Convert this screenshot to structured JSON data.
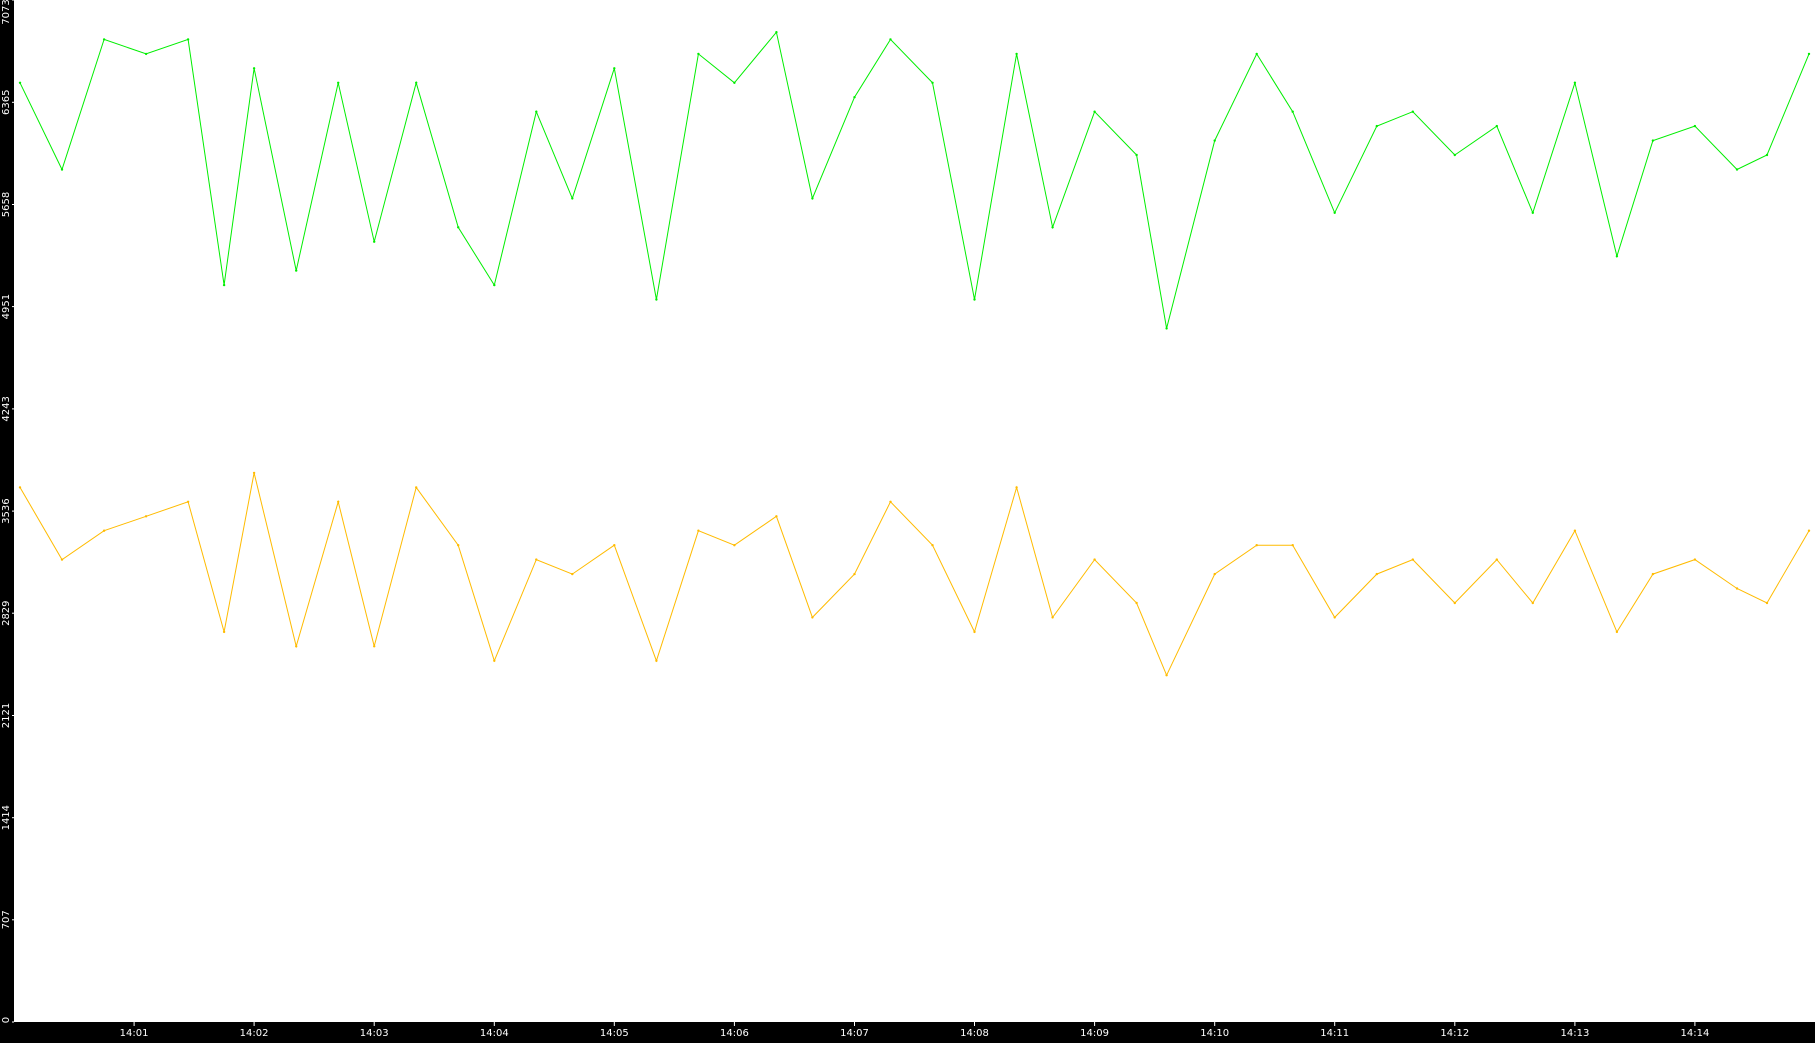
{
  "chart_data": {
    "type": "line",
    "title": "",
    "xlabel": "",
    "ylabel": "",
    "grid": false,
    "legend": "none",
    "colors": {
      "background": "#000000",
      "plot_area": "#ffffff",
      "axis_text": "#ffffff",
      "green_series": "#00ee00",
      "orange_series": "#ffbb00"
    },
    "y_ticks": [
      "0",
      "707",
      "1414",
      "2121",
      "2829",
      "3536",
      "4243",
      "4951",
      "5658",
      "6365",
      "7073"
    ],
    "ylim": [
      0,
      7073
    ],
    "x_ticks": [
      "14:01",
      "14:02",
      "14:03",
      "14:04",
      "14:05",
      "14:06",
      "14:07",
      "14:08",
      "14:09",
      "14:10",
      "14:11",
      "14:12",
      "14:13",
      "14:14"
    ],
    "x_tick_minutes": [
      1,
      2,
      3,
      4,
      5,
      6,
      7,
      8,
      9,
      10,
      11,
      12,
      13,
      14
    ],
    "xlim_minutes": [
      0,
      15
    ],
    "x_unit": "minutes after 14:00",
    "series": [
      {
        "key": "green",
        "x_minutes": [
          0.05,
          0.4,
          0.75,
          1.1,
          1.45,
          1.75,
          2.0,
          2.35,
          2.7,
          3.0,
          3.35,
          3.7,
          4.0,
          4.35,
          4.65,
          5.0,
          5.35,
          5.7,
          6.0,
          6.35,
          6.65,
          7.0,
          7.3,
          7.65,
          8.0,
          8.35,
          8.65,
          9.0,
          9.35,
          9.6,
          10.0,
          10.35,
          10.65,
          11.0,
          11.35,
          11.65,
          12.0,
          12.35,
          12.65,
          13.0,
          13.35,
          13.65,
          14.0,
          14.35,
          14.6,
          14.95
        ],
        "values": [
          6500,
          5900,
          6800,
          6700,
          6800,
          5100,
          6600,
          5200,
          6500,
          5400,
          6500,
          5500,
          5100,
          6300,
          5700,
          6600,
          5000,
          6700,
          6500,
          6850,
          5700,
          6400,
          6800,
          6500,
          5000,
          6700,
          5500,
          6300,
          6000,
          4800,
          6100,
          6700,
          6300,
          5600,
          6200,
          6300,
          6000,
          6200,
          5600,
          6500,
          5300,
          6100,
          6200,
          5900,
          6000,
          6700
        ]
      },
      {
        "key": "orange",
        "x_minutes": [
          0.05,
          0.4,
          0.75,
          1.1,
          1.45,
          1.75,
          2.0,
          2.35,
          2.7,
          3.0,
          3.35,
          3.7,
          4.0,
          4.35,
          4.65,
          5.0,
          5.35,
          5.7,
          6.0,
          6.35,
          6.65,
          7.0,
          7.3,
          7.65,
          8.0,
          8.35,
          8.65,
          9.0,
          9.35,
          9.6,
          10.0,
          10.35,
          10.65,
          11.0,
          11.35,
          11.65,
          12.0,
          12.35,
          12.65,
          13.0,
          13.35,
          13.65,
          14.0,
          14.35,
          14.6,
          14.95
        ],
        "values": [
          3700,
          3200,
          3400,
          3500,
          3600,
          2700,
          3800,
          2600,
          3600,
          2600,
          3700,
          3300,
          2500,
          3200,
          3100,
          3300,
          2500,
          3400,
          3300,
          3500,
          2800,
          3100,
          3600,
          3300,
          2700,
          3700,
          2800,
          3200,
          2900,
          2400,
          3100,
          3300,
          3300,
          2800,
          3100,
          3200,
          2900,
          3200,
          2900,
          3400,
          2700,
          3100,
          3200,
          3000,
          2900,
          3400
        ]
      }
    ]
  }
}
